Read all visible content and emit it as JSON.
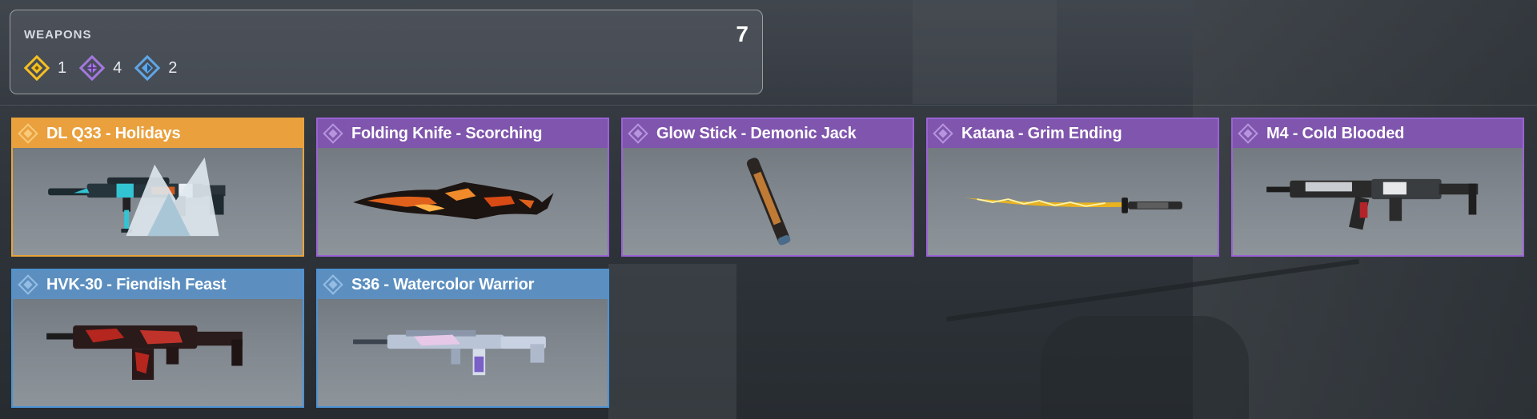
{
  "header": {
    "title": "WEAPONS",
    "total_count": "7",
    "rarities": [
      {
        "name": "legendary",
        "count": "1",
        "color": "#f5c021",
        "icon": "legendary-diamond-icon"
      },
      {
        "name": "epic",
        "count": "4",
        "color": "#a478e0",
        "icon": "epic-diamond-icon"
      },
      {
        "name": "rare",
        "count": "2",
        "color": "#5fa6e6",
        "icon": "rare-diamond-icon"
      }
    ]
  },
  "colors": {
    "legendary_header": "#e9a03d",
    "epic_header": "#7f55ad",
    "rare_header": "#5c8fc0"
  },
  "weapons": [
    {
      "name": "DL Q33 - Holidays",
      "rarity": "legendary",
      "icon": "sniper-rifle-image"
    },
    {
      "name": "Folding Knife - Scorching",
      "rarity": "epic",
      "icon": "knife-image"
    },
    {
      "name": "Glow Stick - Demonic Jack",
      "rarity": "epic",
      "icon": "glow-stick-image"
    },
    {
      "name": "Katana - Grim Ending",
      "rarity": "epic",
      "icon": "katana-image"
    },
    {
      "name": "M4 - Cold Blooded",
      "rarity": "epic",
      "icon": "assault-rifle-image"
    },
    {
      "name": "HVK-30 - Fiendish Feast",
      "rarity": "rare",
      "icon": "rifle-image"
    },
    {
      "name": "S36 - Watercolor Warrior",
      "rarity": "rare",
      "icon": "rifle-image"
    }
  ]
}
